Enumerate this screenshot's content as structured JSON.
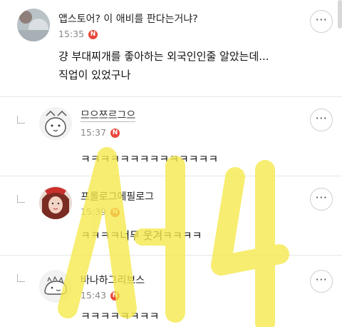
{
  "comments": [
    {
      "nickname": "앱스토어? 이 애비를 판다는거냐?",
      "time": "15:35",
      "badge": "N",
      "lines": [
        "걍 부대찌개를 좋아하는 외국인인줄 알았는데...",
        "직업이 있었구나"
      ],
      "more": "···",
      "is_reply": false
    },
    {
      "nickname": "므으쯔르그으",
      "time": "15:37",
      "badge": "N",
      "lines": [
        "ㅋㅋㅋㅋㅋㅋㅋㅋㅋㅋㅋㅋㅋㅋ"
      ],
      "more": "···",
      "is_reply": true
    },
    {
      "nickname": "프롤로그에필로그",
      "time": "15:39",
      "badge": "N",
      "lines": [
        "ㅋㅋㅋㅋ너무 웃겨ㅋㅋㅋㅋ"
      ],
      "more": "···",
      "is_reply": true
    },
    {
      "nickname": "바나하그리브스",
      "time": "15:43",
      "badge": "N",
      "lines": [
        "ㅋㅋㅋㅋㅋㅋㅋㅋ"
      ],
      "more": "···",
      "is_reply": true
    }
  ],
  "watermark_color": "#f5e94a",
  "badge_color": "#e8483b"
}
